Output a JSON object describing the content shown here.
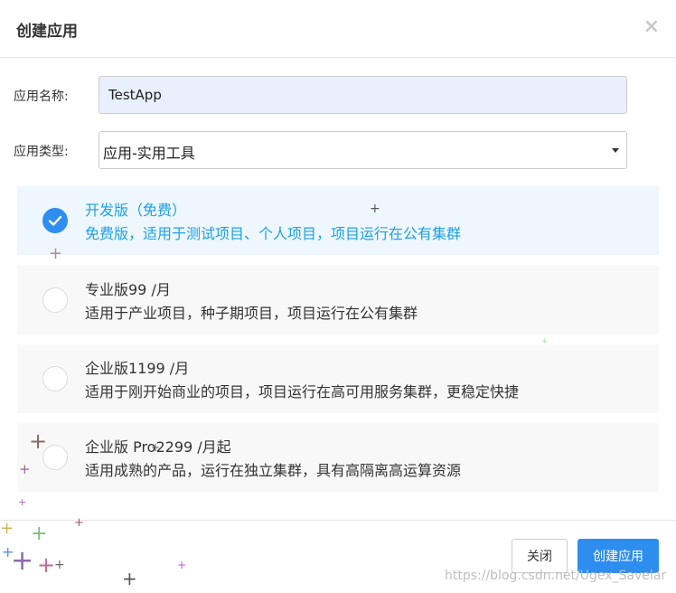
{
  "dialog": {
    "title": "创建应用",
    "close_glyph": "×"
  },
  "form": {
    "name_label": "应用名称:",
    "name_value": "TestApp",
    "type_label": "应用类型:",
    "type_value": "应用-实用工具"
  },
  "plans": [
    {
      "name": "开发版（免费）",
      "desc": "免费版，适用于测试项目、个人项目，项目运行在公有集群",
      "selected": true
    },
    {
      "name": "专业版99 /月",
      "desc": "适用于产业项目，种子期项目，项目运行在公有集群",
      "selected": false
    },
    {
      "name": "企业版1199 /月",
      "desc": "适用于刚开始商业的项目，项目运行在高可用服务集群，更稳定快捷",
      "selected": false
    },
    {
      "name": "企业版 Pro2299 /月起",
      "desc": "适用成熟的产品，运行在独立集群，具有高隔离高运算资源",
      "selected": false
    }
  ],
  "footer": {
    "close_label": "关闭",
    "create_label": "创建应用"
  },
  "watermark": "https://blog.csdn.net/Ugex_Savelar",
  "colors": {
    "accent": "#2d8ef0",
    "selected_text": "#1ea0e6",
    "selected_bg": "#eef7fd",
    "card_bg": "#f8f8f8"
  }
}
